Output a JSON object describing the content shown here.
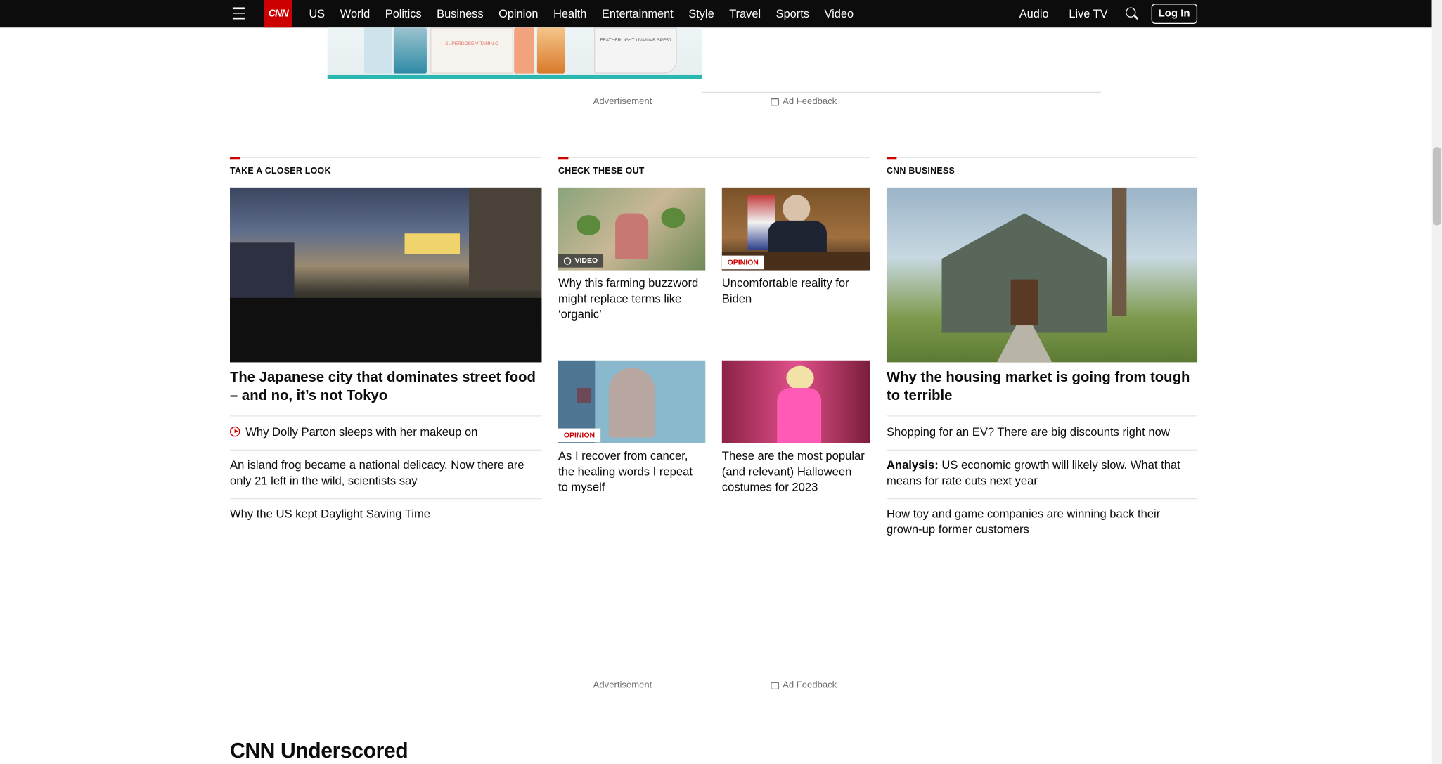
{
  "nav": {
    "logo": "CNN",
    "links": [
      "US",
      "World",
      "Politics",
      "Business",
      "Opinion",
      "Health",
      "Entertainment",
      "Style",
      "Travel",
      "Sports",
      "Video"
    ],
    "right_links": [
      "Audio",
      "Live TV"
    ],
    "login": "Log In"
  },
  "ads": {
    "top_caption": "Advertisement",
    "top_feedback": "Ad Feedback",
    "bottom_caption": "Advertisement",
    "bottom_feedback": "Ad Feedback",
    "bottle_labels": [
      "SUPERDOSE VITAMIN C",
      "FEATHERLIGHT UVA/UVB SPF50"
    ]
  },
  "closer_look": {
    "title": "TAKE A CLOSER LOOK",
    "headline": "The Japanese city that dominates street food – and no, it’s not Tokyo",
    "items": [
      "Why Dolly Parton sleeps with her makeup on",
      "An island frog became a national delicacy. Now there are only 21 left in the wild, scientists say",
      "Why the US kept Daylight Saving Time"
    ]
  },
  "check_out": {
    "title": "CHECK THESE OUT",
    "cards": [
      {
        "badge": "VIDEO",
        "headline": "Why this farming buzzword might replace terms like ‘organic’"
      },
      {
        "badge": "OPINION",
        "headline": "Uncomfortable reality for Biden"
      },
      {
        "badge": "OPINION",
        "headline": "As I recover from cancer, the healing words I repeat to myself"
      },
      {
        "badge": "",
        "headline": "These are the most popular (and relevant) Halloween costumes for 2023"
      }
    ]
  },
  "business": {
    "title": "CNN BUSINESS",
    "headline": "Why the housing market is going from tough to terrible",
    "items": [
      {
        "prefix": "",
        "text": "Shopping for an EV? There are big discounts right now"
      },
      {
        "prefix": "Analysis:",
        "text": " US economic growth will likely slow. What that means for rate cuts next year"
      },
      {
        "prefix": "",
        "text": "How toy and game companies are winning back their grown-up former customers"
      }
    ]
  },
  "underscored": "CNN Underscored"
}
